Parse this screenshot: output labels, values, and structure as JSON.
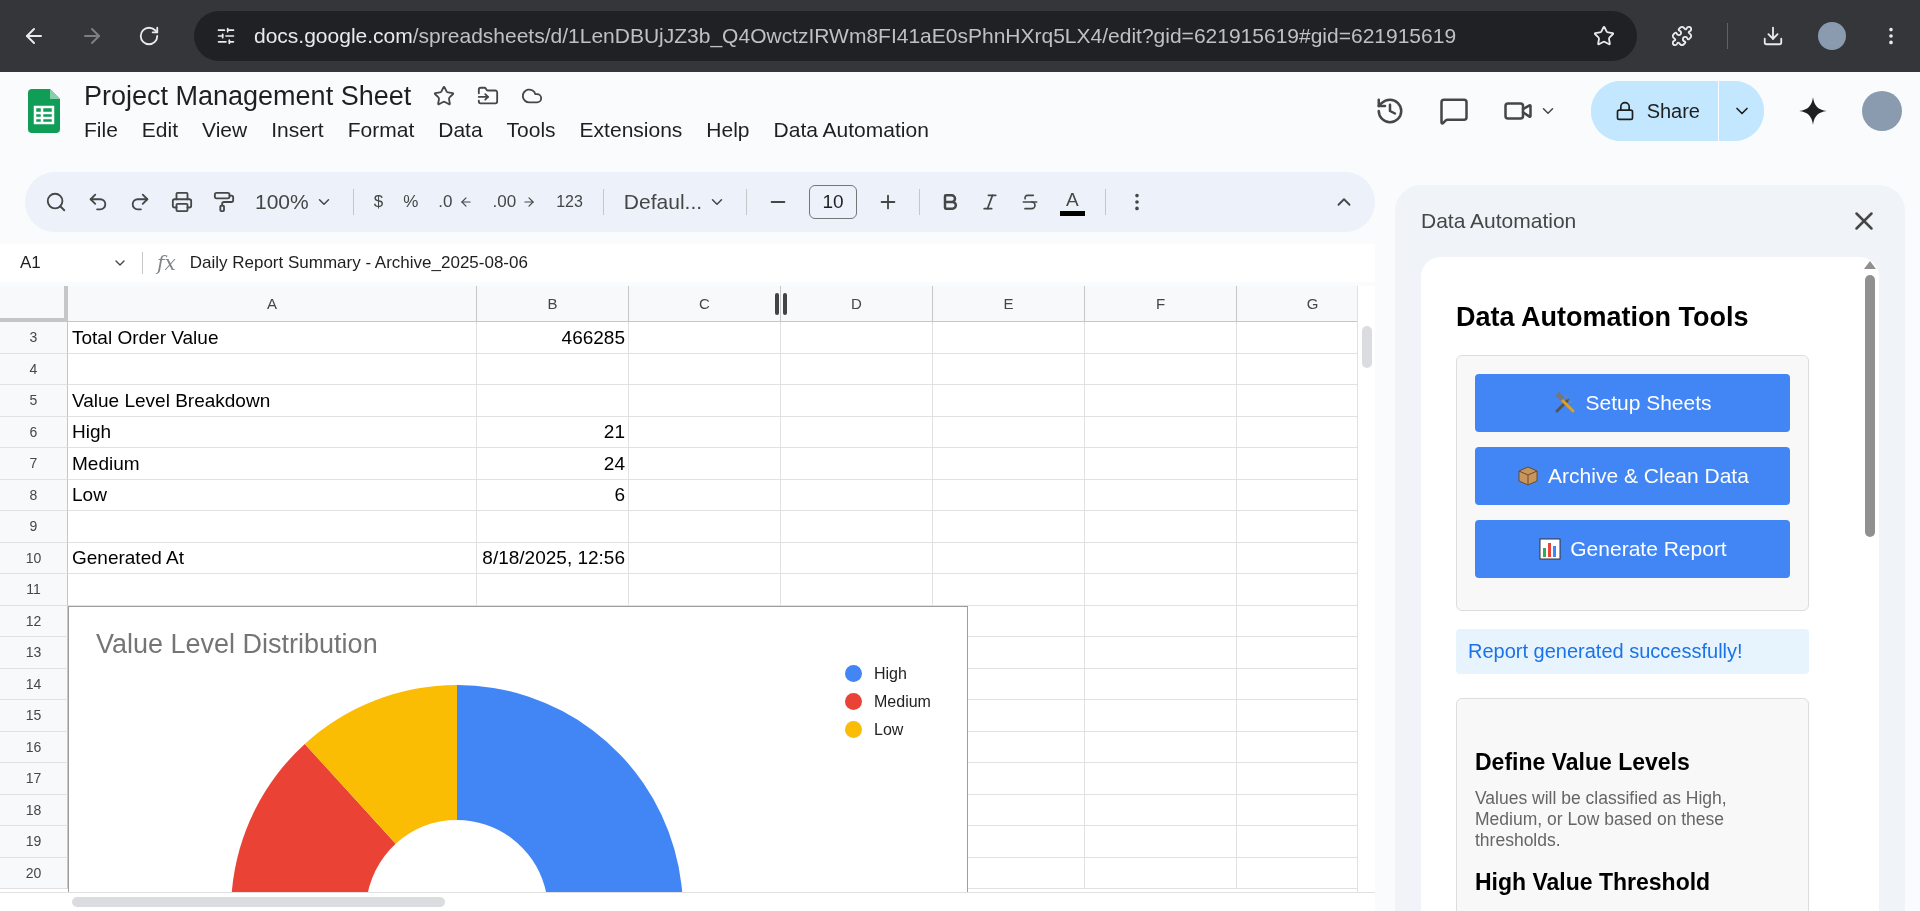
{
  "browser": {
    "url_domain": "docs.google.com",
    "url_path": "/spreadsheets/d/1LenDBUjJZ3b_Q4OwctzIRWm8FI41aE0sPhnHXrq5LX4/edit?gid=621915619#gid=621915619"
  },
  "document": {
    "title": "Project Management Sheet",
    "menu": [
      "File",
      "Edit",
      "View",
      "Insert",
      "Format",
      "Data",
      "Tools",
      "Extensions",
      "Help",
      "Data Automation"
    ],
    "share_label": "Share"
  },
  "toolbar": {
    "zoom": "100%",
    "currency": "$",
    "percent": "%",
    "decimal_decrease": ".0",
    "decimal_increase": ".00",
    "number_format": "123",
    "font": "Defaul...",
    "font_size": "10",
    "text_color_label": "A"
  },
  "formula_bar": {
    "cell_ref": "A1",
    "function_label": "fx",
    "content": "Daily Report Summary - Archive_2025-08-06"
  },
  "sheet": {
    "columns": [
      "A",
      "B",
      "C",
      "D",
      "E",
      "F",
      "G"
    ],
    "rows": [
      {
        "number": "3",
        "cells": [
          {
            "text": "Total Order Value",
            "kind": "text"
          },
          {
            "text": "466285",
            "kind": "number"
          }
        ]
      },
      {
        "number": "4"
      },
      {
        "number": "5",
        "cells": [
          {
            "text": "Value Level Breakdown",
            "kind": "text"
          }
        ]
      },
      {
        "number": "6",
        "cells": [
          {
            "text": "High",
            "kind": "text"
          },
          {
            "text": "21",
            "kind": "number"
          }
        ]
      },
      {
        "number": "7",
        "cells": [
          {
            "text": "Medium",
            "kind": "text"
          },
          {
            "text": "24",
            "kind": "number"
          }
        ]
      },
      {
        "number": "8",
        "cells": [
          {
            "text": "Low",
            "kind": "text"
          },
          {
            "text": "6",
            "kind": "number"
          }
        ]
      },
      {
        "number": "9"
      },
      {
        "number": "10",
        "cells": [
          {
            "text": "Generated At",
            "kind": "text"
          },
          {
            "text": "8/18/2025, 12:56",
            "kind": "number"
          }
        ]
      },
      {
        "number": "11"
      },
      {
        "number": "12"
      },
      {
        "number": "13"
      },
      {
        "number": "14"
      },
      {
        "number": "15"
      },
      {
        "number": "16"
      },
      {
        "number": "17"
      },
      {
        "number": "18"
      },
      {
        "number": "19"
      },
      {
        "number": "20"
      }
    ]
  },
  "chart": {
    "chart_data": {
      "type": "donut",
      "title": "Value Level Distribution",
      "categories": [
        "High",
        "Medium",
        "Low"
      ],
      "values": [
        41.18,
        47.06,
        11.76
      ],
      "colors": [
        "#4285f4",
        "#ea4335",
        "#fbbc04"
      ],
      "legend": "right"
    }
  },
  "side_panel": {
    "title": "Data Automation",
    "heading": "Data Automation Tools",
    "buttons": [
      {
        "label": "Setup Sheets",
        "kind": "tools"
      },
      {
        "label": "Archive & Clean Data",
        "kind": "archive"
      },
      {
        "label": "Generate Report",
        "kind": "chart"
      }
    ],
    "status": "Report generated successfully!",
    "section": {
      "heading": "Define Value Levels",
      "description": "Values will be classified as High, Medium, or Low based on these thresholds.",
      "subheading": "High Value Threshold"
    }
  }
}
